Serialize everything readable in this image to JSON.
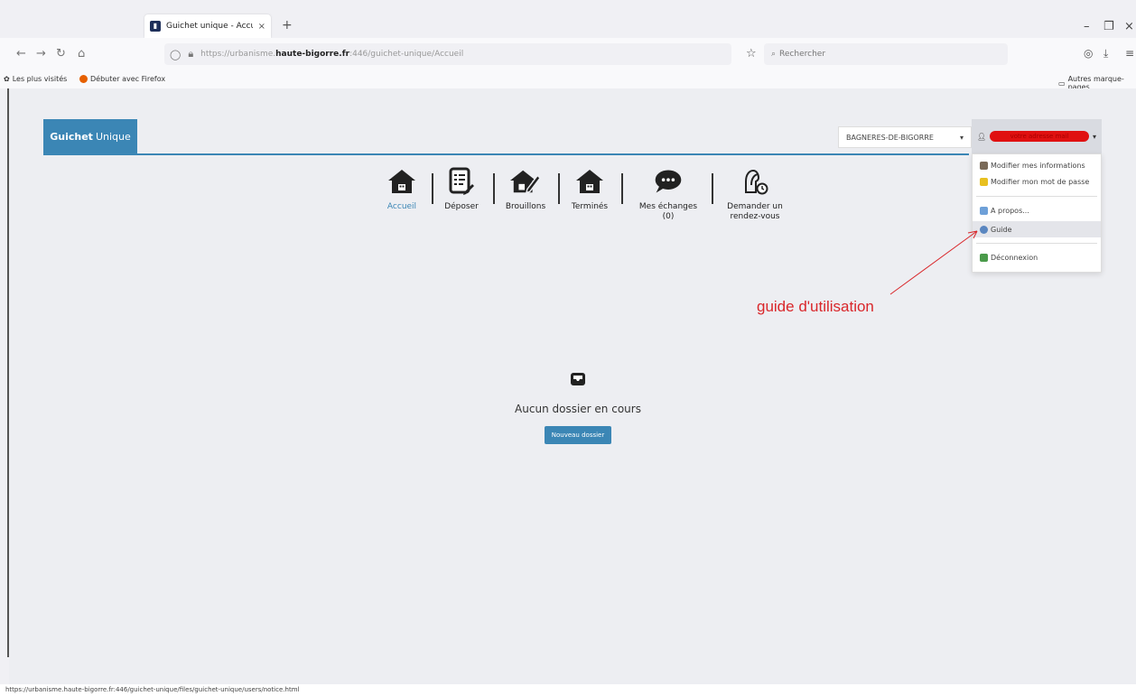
{
  "browser": {
    "tab_title": "Guichet unique - Accueil",
    "tab_close": "×",
    "new_tab": "+",
    "url_prefix": "https://urbanisme.",
    "url_host": "haute-bigorre.fr",
    "url_rest": ":446/guichet-unique/Accueil",
    "search_placeholder": "Rechercher",
    "bookmarks": [
      {
        "label": "Les plus visités"
      },
      {
        "label": "Débuter avec Firefox"
      }
    ],
    "other_bookmarks": "Autres marque-pages",
    "status_url": "https://urbanisme.haute-bigorre.fr:446/guichet-unique/files/guichet-unique/users/notice.html"
  },
  "app": {
    "brand_bold": "Guichet",
    "brand_rest": "Unique",
    "commune": "BAGNERES-DE-BIGORRE",
    "user_label": "votre adresse mail",
    "user_menu": {
      "modify_info": "Modifier mes informations",
      "modify_password": "Modifier mon mot de passe",
      "about": "A propos...",
      "guide": "Guide",
      "logout": "Déconnexion"
    },
    "nav": [
      {
        "label": "Accueil",
        "icon": "home-icon"
      },
      {
        "label": "Déposer",
        "icon": "form-edit-icon"
      },
      {
        "label": "Brouillons",
        "icon": "home-pen-icon"
      },
      {
        "label": "Terminés",
        "icon": "home-icon"
      },
      {
        "label": "Mes échanges",
        "sub": "(0)",
        "icon": "chat-icon"
      },
      {
        "label": "Demander un",
        "sub": "rendez-vous",
        "icon": "appointment-icon"
      }
    ],
    "empty_message": "Aucun dossier en cours",
    "new_button": "Nouveau dossier"
  },
  "annotation": "guide d'utilisation",
  "colors": {
    "accent": "#3b86b5",
    "annotation": "#d9262a"
  }
}
